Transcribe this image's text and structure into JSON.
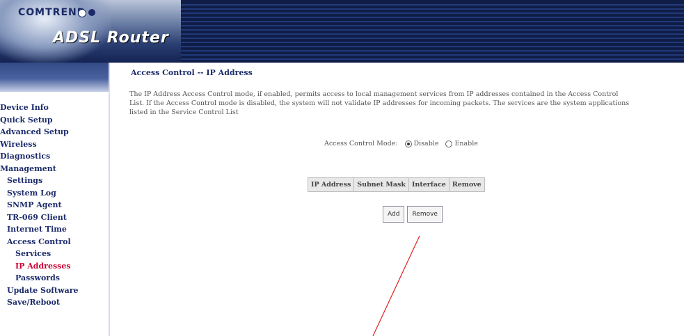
{
  "header": {
    "brand": "COMTREND",
    "product": "ADSL Router"
  },
  "sidebar": {
    "items": [
      {
        "label": "Device Info",
        "level": 0
      },
      {
        "label": "Quick Setup",
        "level": 0
      },
      {
        "label": "Advanced Setup",
        "level": 0
      },
      {
        "label": "Wireless",
        "level": 0
      },
      {
        "label": "Diagnostics",
        "level": 0
      },
      {
        "label": "Management",
        "level": 0
      },
      {
        "label": "Settings",
        "level": 1
      },
      {
        "label": "System Log",
        "level": 1
      },
      {
        "label": "SNMP Agent",
        "level": 1
      },
      {
        "label": "TR-069 Client",
        "level": 1
      },
      {
        "label": "Internet Time",
        "level": 1
      },
      {
        "label": "Access Control",
        "level": 1
      },
      {
        "label": "Services",
        "level": 2
      },
      {
        "label": "IP Addresses",
        "level": 2,
        "active": true
      },
      {
        "label": "Passwords",
        "level": 2
      },
      {
        "label": "Update Software",
        "level": 1
      },
      {
        "label": "Save/Reboot",
        "level": 1
      }
    ]
  },
  "main": {
    "title": "Access Control -- IP Address",
    "description": [
      "The IP Address Access Control mode, if enabled, permits access to local management services from IP addresses contained in the Access Control",
      "List. If the Access Control mode is disabled, the system will not validate IP addresses for incoming packets. The services are the system applications",
      "listed in the Service Control List"
    ],
    "mode_label": "Access Control Mode:",
    "mode_options": [
      {
        "label": "Disable",
        "checked": true
      },
      {
        "label": "Enable",
        "checked": false
      }
    ],
    "table_headers": [
      "IP Address",
      "Subnet Mask",
      "Interface",
      "Remove"
    ],
    "buttons": {
      "add": "Add",
      "remove": "Remove"
    }
  },
  "colors": {
    "nav_text": "#1d2c6b",
    "nav_active": "#cc0033",
    "annotation_line": "#e0201c"
  }
}
